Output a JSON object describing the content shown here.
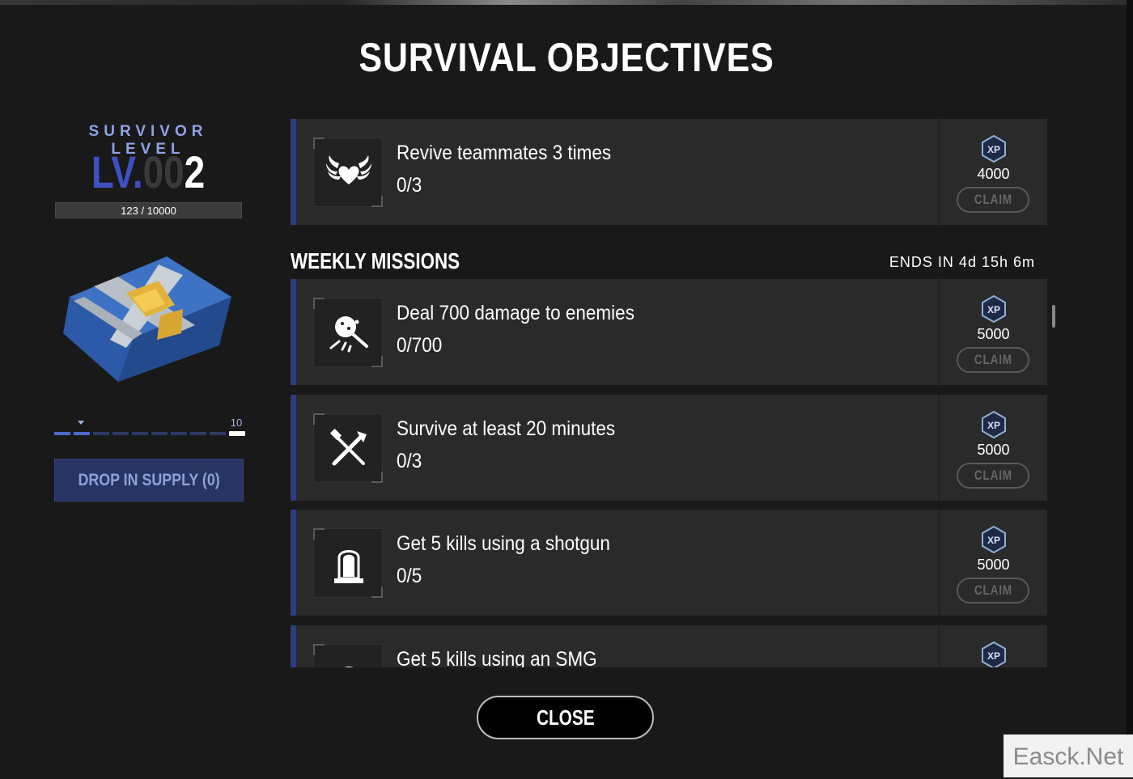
{
  "header": {
    "title": "SURVIVAL OBJECTIVES"
  },
  "survivor": {
    "label": "SURVIVOR LEVEL",
    "level_prefix": "LV.",
    "level_zeros": "00",
    "level_number": "2",
    "xp_text": "123 / 10000",
    "xp_progress": 0.0123,
    "track_end_label": "10",
    "track_segments": 10,
    "track_filled": 2,
    "drop_button": "DROP IN SUPPLY (0)"
  },
  "objectives": [
    {
      "title": "Revive teammates 3 times",
      "progress": "0/3",
      "xp": "4000",
      "claim": "CLAIM",
      "icon": "wings-heart-icon"
    }
  ],
  "weekly": {
    "heading": "WEEKLY MISSIONS",
    "ends_in": "ENDS IN 4d 15h 6m",
    "missions": [
      {
        "title": "Deal 700 damage to enemies",
        "progress": "0/700",
        "xp": "5000",
        "claim": "CLAIM",
        "icon": "frying-pan-icon"
      },
      {
        "title": "Survive at least 20 minutes",
        "progress": "0/3",
        "xp": "5000",
        "claim": "CLAIM",
        "icon": "crossed-tools-icon"
      },
      {
        "title": "Get 5 kills using a shotgun",
        "progress": "0/5",
        "xp": "5000",
        "claim": "CLAIM",
        "icon": "tombstone-icon"
      },
      {
        "title": "Get 5 kills using an SMG",
        "progress": "",
        "xp": "",
        "claim": "",
        "icon": "helmet-icon"
      }
    ]
  },
  "badge": {
    "xp_label": "XP"
  },
  "footer": {
    "close": "CLOSE"
  },
  "watermark": "Easck.Net",
  "colors": {
    "accent": "#2f3c80",
    "xp_badge": "#8fb0d8",
    "background": "#191919"
  }
}
